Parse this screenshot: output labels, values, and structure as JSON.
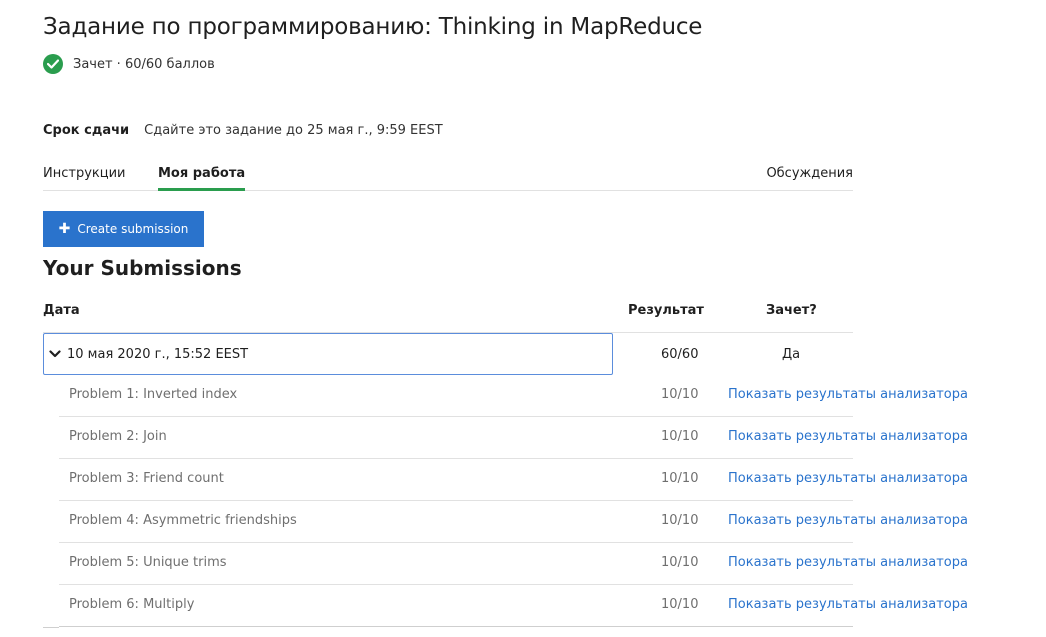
{
  "header": {
    "title": "Задание по программированию: Thinking in MapReduce",
    "status_text": "Зачет · 60/60 баллов"
  },
  "deadline": {
    "label": "Срок сдачи",
    "text": "Сдайте это задание до 25 мая г., 9:59 EEST"
  },
  "tabs": [
    {
      "label": "Инструкции",
      "active": false
    },
    {
      "label": "Моя работа",
      "active": true
    },
    {
      "label": "Обсуждения",
      "active": false
    }
  ],
  "create_button": {
    "label": "Create submission"
  },
  "submissions": {
    "title": "Your Submissions",
    "columns": {
      "date": "Дата",
      "result": "Результат",
      "passed": "Зачет?"
    },
    "row": {
      "date": "10 мая 2020 г., 15:52 EEST",
      "score": "60/60",
      "passed": "Да"
    },
    "problems": [
      {
        "name": "Problem 1: Inverted index",
        "score": "10/10",
        "link": "Показать результаты анализатора"
      },
      {
        "name": "Problem 2: Join",
        "score": "10/10",
        "link": "Показать результаты анализатора"
      },
      {
        "name": "Problem 3: Friend count",
        "score": "10/10",
        "link": "Показать результаты анализатора"
      },
      {
        "name": "Problem 4: Asymmetric friendships",
        "score": "10/10",
        "link": "Показать результаты анализатора"
      },
      {
        "name": "Problem 5: Unique trims",
        "score": "10/10",
        "link": "Показать результаты анализатора"
      },
      {
        "name": "Problem 6: Multiply",
        "score": "10/10",
        "link": "Показать результаты анализатора"
      }
    ]
  },
  "colors": {
    "accent": "#2a9d4e",
    "primary": "#2a73cc",
    "focus": "#5b8ddc"
  },
  "icons": {
    "status": "check-circle-icon",
    "create": "plus-icon",
    "expand": "chevron-down-icon"
  }
}
